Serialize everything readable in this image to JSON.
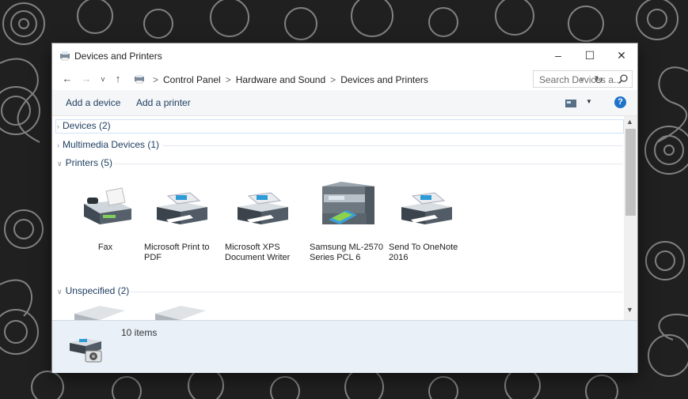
{
  "window": {
    "title": "Devices and Printers",
    "controls": {
      "minimize": "–",
      "maximize": "☐",
      "close": "✕"
    }
  },
  "address": {
    "back": "←",
    "forward": "→",
    "dropdown": "v",
    "up": "↑",
    "breadcrumb": [
      "Control Panel",
      "Hardware and Sound",
      "Devices and Printers"
    ],
    "separator": ">",
    "search_placeholder": "Search Devices a..."
  },
  "toolbar": {
    "add_device": "Add a device",
    "add_printer": "Add a printer",
    "help": "?"
  },
  "groups": {
    "devices": "Devices (2)",
    "multimedia": "Multimedia Devices (1)",
    "printers": "Printers (5)",
    "unspecified": "Unspecified (2)"
  },
  "printers": [
    {
      "name": "Fax",
      "icon": "fax-icon"
    },
    {
      "name": "Microsoft Print to PDF",
      "icon": "printer-icon"
    },
    {
      "name": "Microsoft XPS Document Writer",
      "icon": "printer-icon"
    },
    {
      "name": "Samsung ML-2570 Series PCL 6",
      "icon": "multifunction-printer-icon"
    },
    {
      "name": "Send To OneNote 2016",
      "icon": "printer-icon"
    }
  ],
  "details": {
    "count": "10 items",
    "icon": "devices-camera-icon"
  },
  "colors": {
    "link": "#1e3f62",
    "help": "#1e73c8",
    "details_bg": "#e9f0f8"
  }
}
